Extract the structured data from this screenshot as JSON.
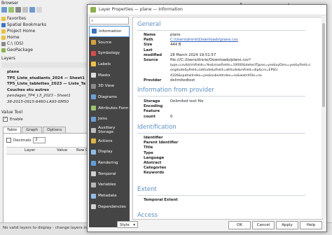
{
  "browser": {
    "title": "Browser",
    "items": [
      {
        "label": "Favorites",
        "color": "#e8c33b"
      },
      {
        "label": "Spatial Bookmarks",
        "color": "#3b73c6"
      },
      {
        "label": "Project Home",
        "color": "#e8c33b"
      },
      {
        "label": "Home",
        "color": "#e8c33b"
      },
      {
        "label": "C:\\ (OS)",
        "color": "#888888"
      },
      {
        "label": "GeoPackage",
        "color": "#8bb24a"
      }
    ]
  },
  "layers": {
    "title": "Layers",
    "items": [
      {
        "label": "plane",
        "style": "bold"
      },
      {
        "label": "TP5_Liste_etudiants_2024 — Sheet1",
        "style": "bold"
      },
      {
        "label": "TP5_Liste_tablettes_2023 — Liste_Ta",
        "style": "bold"
      },
      {
        "label": "Couches etu autres",
        "style": "bold"
      },
      {
        "label": "pendages_TP4_L3_2023 - Sheet1",
        "style": "italic"
      },
      {
        "label": "38-2015-0915-6460-LA93-0M50",
        "style": "italic"
      }
    ]
  },
  "value_tool": {
    "title": "Value Tool",
    "enable_label": "Enable",
    "tabs": [
      "Table",
      "Graph",
      "Options"
    ],
    "decimals_label": "Decimals",
    "decimals_value": "2",
    "columns": [
      "Layer",
      "Value",
      "Row"
    ],
    "col_partial": "C"
  },
  "status": {
    "text": "No valid layers to display - change layers in options"
  },
  "map_text": "oble",
  "dialog": {
    "title": "Layer Properties — plane — Information",
    "sidebar": [
      {
        "label": "Information",
        "color": "#3b73c6",
        "active": true
      },
      {
        "label": "Source",
        "color": "#d6a13a"
      },
      {
        "label": "Symbology",
        "color": "#d94a4a"
      },
      {
        "label": "Labels",
        "color": "#f0c040"
      },
      {
        "label": "Masks",
        "color": "#dddddd"
      },
      {
        "label": "3D View",
        "color": "#8a8a8a"
      },
      {
        "label": "Diagrams",
        "color": "#6aa0d8"
      },
      {
        "label": "Attributes Form",
        "color": "#9bc46a"
      },
      {
        "label": "Joins",
        "color": "#6aa0d8"
      },
      {
        "label": "Auxiliary Storage",
        "color": "#c0c0c0"
      },
      {
        "label": "Actions",
        "color": "#e2b53c"
      },
      {
        "label": "Display",
        "color": "#8fbde8"
      },
      {
        "label": "Rendering",
        "color": "#5da0e0"
      },
      {
        "label": "Temporal",
        "color": "#cfcfcf"
      },
      {
        "label": "Variables",
        "color": "#b8b8b8"
      },
      {
        "label": "Metadata",
        "color": "#8fbde8"
      },
      {
        "label": "Dependencies",
        "color": "#cfcfcf"
      }
    ],
    "sections": {
      "general": {
        "title": "General",
        "rows": [
          {
            "k": "Name",
            "v": "plane"
          },
          {
            "k": "Path",
            "v": "C:\\Users\\drsrie\\Downloads\\plane.csv",
            "link": true
          },
          {
            "k": "Size",
            "v": "444 B"
          },
          {
            "k": "Last modified",
            "v": "28 March 2024 19:51:57"
          },
          {
            "k": "Source",
            "v": "file:///C:/Users/drsrie/Downloads/plane.csv?"
          },
          {
            "k": "",
            "v": "type=csv&trimFields=Yes&maxFields=10000&detectTypes=yes&xyDms=yes&yField=l"
          },
          {
            "k": "",
            "v": "ongitude&yField=latitude&zField=altitude&mField=dip&crs=EPSG:"
          },
          {
            "k": "",
            "v": "4326&spatialIndex=yes&subsetIndex=no&watchFile=no"
          },
          {
            "k": "Provider",
            "v": "delimitedtext"
          }
        ]
      },
      "from_provider": {
        "title": "Information from provider",
        "rows": [
          {
            "k": "Storage",
            "v": "Delimited text file"
          },
          {
            "k": "Encoding",
            "v": ""
          },
          {
            "k": "Feature count",
            "v": "0"
          }
        ]
      },
      "identification": {
        "title": "Identification",
        "rows": [
          "Identifier",
          "Parent Identifier",
          "Title",
          "Type",
          "Language",
          "Abstract",
          "Categories",
          "Keywords"
        ]
      },
      "extent": {
        "title": "Extent",
        "rows": [
          "Temporal Extent"
        ]
      },
      "access": {
        "title": "Access"
      }
    },
    "buttons": {
      "style": "Style",
      "ok": "OK",
      "cancel": "Cancel",
      "apply": "Apply",
      "help": "Help"
    }
  }
}
